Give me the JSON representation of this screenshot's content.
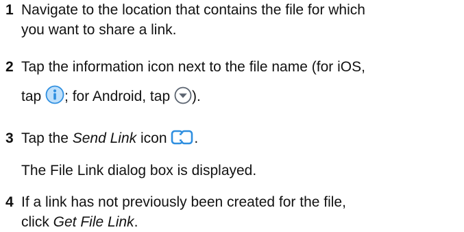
{
  "steps": [
    {
      "number": "1",
      "lines": [
        "Navigate to the location that contains the file for which",
        "you want to share a link."
      ]
    },
    {
      "number": "2",
      "line1": "Tap the information icon next to the file name (for iOS,",
      "line2_prefix": "tap ",
      "line2_middle": "; for Android, tap ",
      "line2_suffix": ")."
    },
    {
      "number": "3",
      "prefix": "Tap the ",
      "emphasis": "Send Link",
      "suffix": " icon ",
      "end": "."
    },
    {
      "number": "4",
      "line1": "If a link has not previously been created for the file,",
      "line2_prefix": "click ",
      "line2_emphasis": "Get File Link",
      "line2_suffix": "."
    }
  ],
  "note_after_step3": "The File Link dialog box is displayed.",
  "icons": {
    "ios_info": "info-circle-icon",
    "android_dropdown": "chevron-down-circle-icon",
    "send_link": "send-link-icon"
  },
  "colors": {
    "text": "#111111",
    "icon_blue": "#2f8fe0",
    "icon_light_blue": "#bfe0fb",
    "icon_gray": "#5b6470"
  }
}
